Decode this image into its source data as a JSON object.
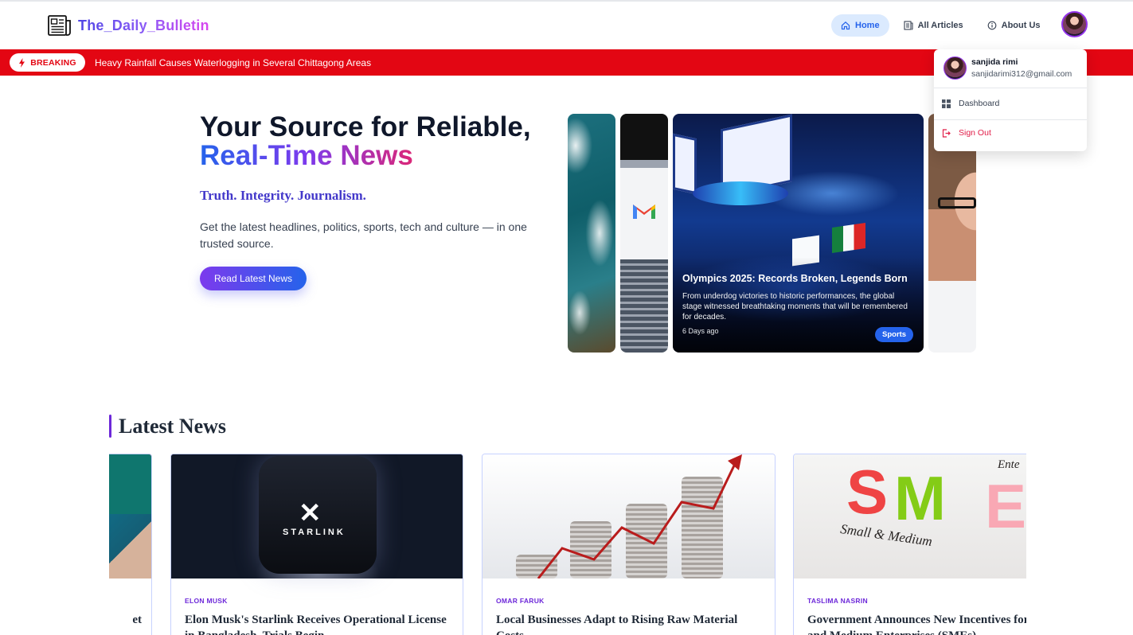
{
  "brand": {
    "name": "The_Daily_Bulletin"
  },
  "nav": {
    "links": [
      {
        "label": "Home",
        "active": true,
        "icon": "home-icon"
      },
      {
        "label": "All Articles",
        "active": false,
        "icon": "newspaper-icon"
      },
      {
        "label": "About Us",
        "active": false,
        "icon": "info-icon"
      }
    ]
  },
  "breaking": {
    "badge": "BREAKING",
    "text": "Heavy Rainfall Causes Waterlogging in Several Chittagong Areas"
  },
  "user_menu": {
    "name": "sanjida rimi",
    "email": "sanjidarimi312@gmail.com",
    "dashboard_label": "Dashboard",
    "signout_label": "Sign Out"
  },
  "hero": {
    "title_line1": "Your Source for Reliable,",
    "title_line2": "Real-Time News",
    "tagline": "Truth. Integrity. Journalism.",
    "description": "Get the latest headlines, politics, sports, tech and culture — in one trusted source.",
    "cta_label": "Read Latest News"
  },
  "featured_slide": {
    "title": "Olympics 2025: Records Broken, Legends Born",
    "description": "From underdog victories to historic performances, the global stage witnessed breathtaking moments that will be remembered for decades.",
    "time": "6 Days ago",
    "category": "Sports"
  },
  "latest_news": {
    "heading": "Latest News",
    "cards": [
      {
        "author": "",
        "title": "et"
      },
      {
        "author": "ELON MUSK",
        "title": "Elon Musk's Starlink Receives Operational License in Bangladesh, Trials Begin"
      },
      {
        "author": "OMAR FARUK",
        "title": "Local Businesses Adapt to Rising Raw Material Costs"
      },
      {
        "author": "TASLIMA NASRIN",
        "title": "Government Announces New Incentives for Small and Medium Enterprises (SMEs)"
      }
    ]
  },
  "image_text": {
    "starlink": "STARLINK",
    "sme_letters": [
      "S",
      "M",
      "E"
    ],
    "sme_caption": "Small & Medium",
    "sme_corner": "Ente"
  },
  "colors": {
    "breaking_red": "#e30613",
    "accent_purple": "#6d28d9",
    "accent_blue": "#2563eb"
  }
}
